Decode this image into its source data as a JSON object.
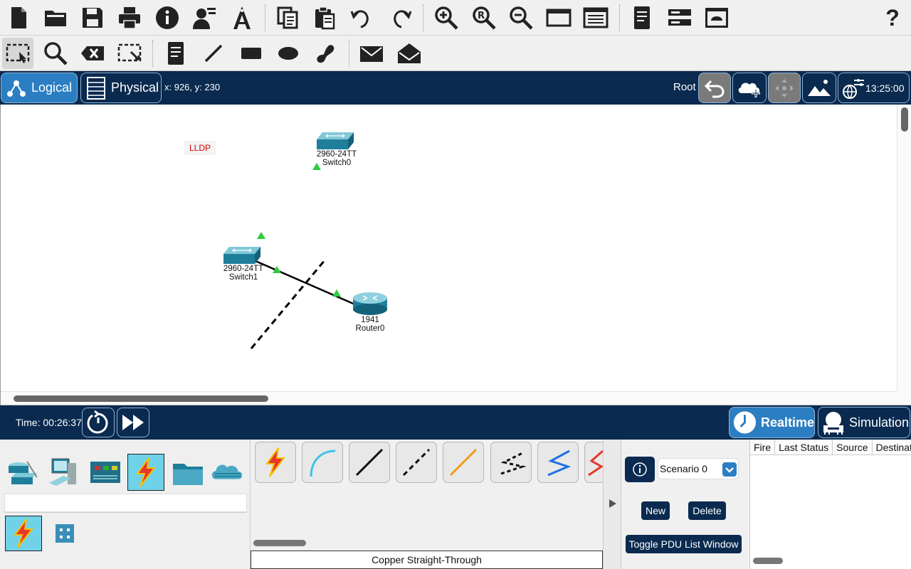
{
  "toolbar_top": {
    "icons": [
      "new-file-icon",
      "open-folder-icon",
      "save-icon",
      "print-icon",
      "info-icon",
      "user-profile-icon",
      "activity-wizard-icon",
      "copy-icon",
      "paste-icon",
      "undo-icon",
      "redo-icon",
      "zoom-in-icon",
      "zoom-reset-icon",
      "zoom-out-icon",
      "drawing-palette-icon",
      "custom-devices-icon",
      "notes-icon",
      "cluster-icon",
      "viewport-icon",
      "help-icon"
    ],
    "help_label": "?"
  },
  "toolbar_tools": {
    "icons": [
      "select-icon",
      "inspect-icon",
      "delete-icon",
      "resize-icon",
      "place-note-icon",
      "draw-line-icon",
      "draw-rectangle-icon",
      "draw-ellipse-icon",
      "freeform-icon",
      "add-simple-pdu-icon",
      "add-complex-pdu-icon"
    ]
  },
  "navbar": {
    "logical_label": "Logical",
    "physical_label": "Physical",
    "coords": "x: 926, y: 230",
    "root_label": "Root",
    "clock": "13:25:00"
  },
  "workspace": {
    "note": "LLDP",
    "devices": [
      {
        "model": "2960-24TT",
        "name": "Switch0"
      },
      {
        "model": "2960-24TT",
        "name": "Switch1"
      },
      {
        "model": "1941",
        "name": "Router0"
      }
    ]
  },
  "timebar": {
    "time": "Time: 00:26:37",
    "realtime_label": "Realtime",
    "simulation_label": "Simulation"
  },
  "device_categories": [
    "network-devices",
    "end-devices",
    "components",
    "connections",
    "miscellaneous",
    "multiuser-connection"
  ],
  "connections": {
    "cables": [
      "automatic",
      "console",
      "copper-straight-through",
      "copper-cross-over",
      "fiber",
      "phone",
      "coaxial",
      "serial"
    ],
    "selected_name": "Copper Straight-Through"
  },
  "scenario": {
    "selected": "Scenario 0",
    "new_label": "New",
    "delete_label": "Delete",
    "toggle_label": "Toggle PDU List Window"
  },
  "pdu_table": {
    "columns": [
      "Fire",
      "Last Status",
      "Source",
      "Destination"
    ]
  },
  "colors": {
    "navy": "#0a2a4f",
    "accent_blue": "#2b7ec2",
    "link_up": "#2ecc40",
    "note_red": "#d40000"
  }
}
